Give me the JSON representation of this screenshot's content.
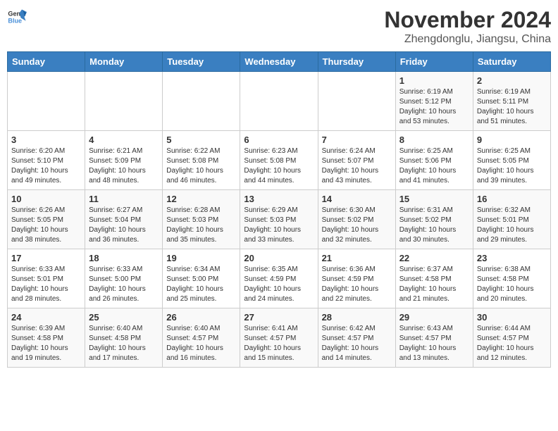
{
  "header": {
    "logo_general": "General",
    "logo_blue": "Blue",
    "month": "November 2024",
    "location": "Zhengdonglu, Jiangsu, China"
  },
  "weekdays": [
    "Sunday",
    "Monday",
    "Tuesday",
    "Wednesday",
    "Thursday",
    "Friday",
    "Saturday"
  ],
  "weeks": [
    [
      {
        "day": "",
        "info": ""
      },
      {
        "day": "",
        "info": ""
      },
      {
        "day": "",
        "info": ""
      },
      {
        "day": "",
        "info": ""
      },
      {
        "day": "",
        "info": ""
      },
      {
        "day": "1",
        "info": "Sunrise: 6:19 AM\nSunset: 5:12 PM\nDaylight: 10 hours and 53 minutes."
      },
      {
        "day": "2",
        "info": "Sunrise: 6:19 AM\nSunset: 5:11 PM\nDaylight: 10 hours and 51 minutes."
      }
    ],
    [
      {
        "day": "3",
        "info": "Sunrise: 6:20 AM\nSunset: 5:10 PM\nDaylight: 10 hours and 49 minutes."
      },
      {
        "day": "4",
        "info": "Sunrise: 6:21 AM\nSunset: 5:09 PM\nDaylight: 10 hours and 48 minutes."
      },
      {
        "day": "5",
        "info": "Sunrise: 6:22 AM\nSunset: 5:08 PM\nDaylight: 10 hours and 46 minutes."
      },
      {
        "day": "6",
        "info": "Sunrise: 6:23 AM\nSunset: 5:08 PM\nDaylight: 10 hours and 44 minutes."
      },
      {
        "day": "7",
        "info": "Sunrise: 6:24 AM\nSunset: 5:07 PM\nDaylight: 10 hours and 43 minutes."
      },
      {
        "day": "8",
        "info": "Sunrise: 6:25 AM\nSunset: 5:06 PM\nDaylight: 10 hours and 41 minutes."
      },
      {
        "day": "9",
        "info": "Sunrise: 6:25 AM\nSunset: 5:05 PM\nDaylight: 10 hours and 39 minutes."
      }
    ],
    [
      {
        "day": "10",
        "info": "Sunrise: 6:26 AM\nSunset: 5:05 PM\nDaylight: 10 hours and 38 minutes."
      },
      {
        "day": "11",
        "info": "Sunrise: 6:27 AM\nSunset: 5:04 PM\nDaylight: 10 hours and 36 minutes."
      },
      {
        "day": "12",
        "info": "Sunrise: 6:28 AM\nSunset: 5:03 PM\nDaylight: 10 hours and 35 minutes."
      },
      {
        "day": "13",
        "info": "Sunrise: 6:29 AM\nSunset: 5:03 PM\nDaylight: 10 hours and 33 minutes."
      },
      {
        "day": "14",
        "info": "Sunrise: 6:30 AM\nSunset: 5:02 PM\nDaylight: 10 hours and 32 minutes."
      },
      {
        "day": "15",
        "info": "Sunrise: 6:31 AM\nSunset: 5:02 PM\nDaylight: 10 hours and 30 minutes."
      },
      {
        "day": "16",
        "info": "Sunrise: 6:32 AM\nSunset: 5:01 PM\nDaylight: 10 hours and 29 minutes."
      }
    ],
    [
      {
        "day": "17",
        "info": "Sunrise: 6:33 AM\nSunset: 5:01 PM\nDaylight: 10 hours and 28 minutes."
      },
      {
        "day": "18",
        "info": "Sunrise: 6:33 AM\nSunset: 5:00 PM\nDaylight: 10 hours and 26 minutes."
      },
      {
        "day": "19",
        "info": "Sunrise: 6:34 AM\nSunset: 5:00 PM\nDaylight: 10 hours and 25 minutes."
      },
      {
        "day": "20",
        "info": "Sunrise: 6:35 AM\nSunset: 4:59 PM\nDaylight: 10 hours and 24 minutes."
      },
      {
        "day": "21",
        "info": "Sunrise: 6:36 AM\nSunset: 4:59 PM\nDaylight: 10 hours and 22 minutes."
      },
      {
        "day": "22",
        "info": "Sunrise: 6:37 AM\nSunset: 4:58 PM\nDaylight: 10 hours and 21 minutes."
      },
      {
        "day": "23",
        "info": "Sunrise: 6:38 AM\nSunset: 4:58 PM\nDaylight: 10 hours and 20 minutes."
      }
    ],
    [
      {
        "day": "24",
        "info": "Sunrise: 6:39 AM\nSunset: 4:58 PM\nDaylight: 10 hours and 19 minutes."
      },
      {
        "day": "25",
        "info": "Sunrise: 6:40 AM\nSunset: 4:58 PM\nDaylight: 10 hours and 17 minutes."
      },
      {
        "day": "26",
        "info": "Sunrise: 6:40 AM\nSunset: 4:57 PM\nDaylight: 10 hours and 16 minutes."
      },
      {
        "day": "27",
        "info": "Sunrise: 6:41 AM\nSunset: 4:57 PM\nDaylight: 10 hours and 15 minutes."
      },
      {
        "day": "28",
        "info": "Sunrise: 6:42 AM\nSunset: 4:57 PM\nDaylight: 10 hours and 14 minutes."
      },
      {
        "day": "29",
        "info": "Sunrise: 6:43 AM\nSunset: 4:57 PM\nDaylight: 10 hours and 13 minutes."
      },
      {
        "day": "30",
        "info": "Sunrise: 6:44 AM\nSunset: 4:57 PM\nDaylight: 10 hours and 12 minutes."
      }
    ]
  ]
}
